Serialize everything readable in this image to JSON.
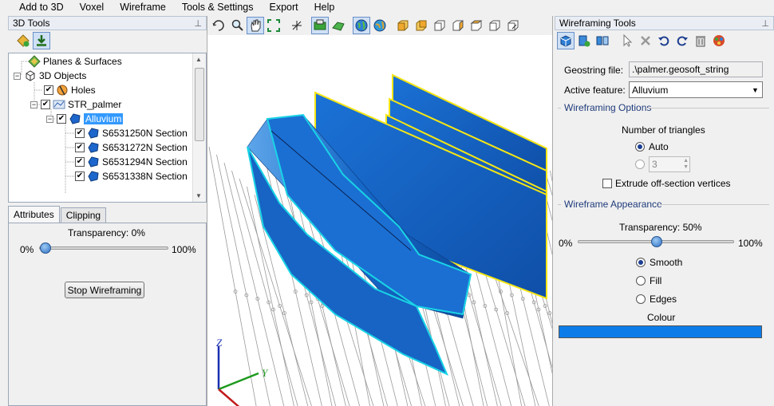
{
  "menu": [
    "Add to 3D",
    "Voxel",
    "Wireframe",
    "Tools & Settings",
    "Export",
    "Help"
  ],
  "left_panel": {
    "title": "3D Tools",
    "tree": [
      {
        "label": "Planes & Surfaces",
        "icon": "planes-surfaces-icon"
      },
      {
        "label": "3D Objects",
        "icon": "objects-icon"
      },
      {
        "label": "Holes",
        "icon": "holes-icon"
      },
      {
        "label": "STR_palmer",
        "icon": "string-icon"
      },
      {
        "label": "Alluvium",
        "icon": "section-icon"
      },
      {
        "label": "S6531250N Section",
        "icon": "section-icon"
      },
      {
        "label": "S6531272N Section",
        "icon": "section-icon"
      },
      {
        "label": "S6531294N Section",
        "icon": "section-icon"
      },
      {
        "label": "S6531338N Section",
        "icon": "section-icon"
      }
    ],
    "tabs": [
      "Attributes",
      "Clipping"
    ],
    "transparency_label": "Transparency: 0%",
    "slider_min": "0%",
    "slider_max": "100%",
    "transparency_value": 0,
    "stop_button": "Stop Wireframing"
  },
  "viewport": {
    "axes": [
      "Z",
      "Y",
      "X"
    ],
    "colors": {
      "surface": "#1560c8",
      "outline": "#19d3e6",
      "section_outline": "#f5e614",
      "axis_z": "#1a2fb0",
      "axis_y": "#1d9a1d",
      "axis_x": "#c21b1b"
    }
  },
  "right_panel": {
    "title": "Wireframing Tools",
    "geostring_label": "Geostring file:",
    "geostring_value": ".\\palmer.geosoft_string",
    "active_feature_label": "Active feature:",
    "active_feature_value": "Alluvium",
    "options_group": "Wireframing Options",
    "triangles_label": "Number of triangles",
    "auto_label": "Auto",
    "triangles_value": "3",
    "extrude_label": "Extrude off-section vertices",
    "appearance_group": "Wireframe Appearance",
    "transparency_label": "Transparency: 50%",
    "slider_min": "0%",
    "slider_max": "100%",
    "transparency_value": 50,
    "smooth_label": "Smooth",
    "fill_label": "Fill",
    "edges_label": "Edges",
    "colour_label": "Colour",
    "colour_value": "#0c7de8"
  }
}
